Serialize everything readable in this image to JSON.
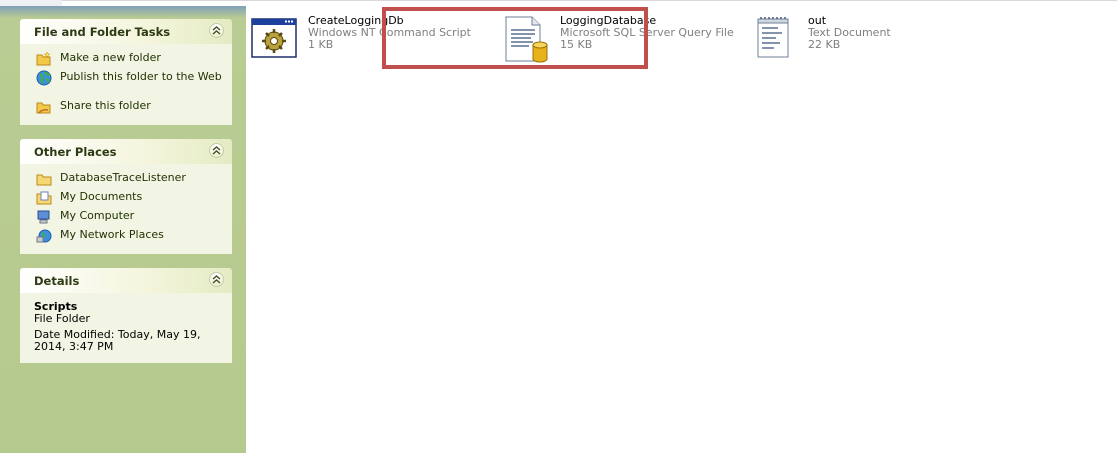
{
  "task_pane": {
    "file_folder_tasks": {
      "title": "File and Folder Tasks",
      "items": [
        {
          "label": "Make a new folder",
          "icon": "new-folder-icon"
        },
        {
          "label": "Publish this folder to the Web",
          "icon": "publish-web-icon"
        },
        {
          "label": "Share this folder",
          "icon": "share-folder-icon"
        }
      ]
    },
    "other_places": {
      "title": "Other Places",
      "items": [
        {
          "label": "DatabaseTraceListener",
          "icon": "folder-icon"
        },
        {
          "label": "My Documents",
          "icon": "my-documents-icon"
        },
        {
          "label": "My Computer",
          "icon": "my-computer-icon"
        },
        {
          "label": "My Network Places",
          "icon": "network-places-icon"
        }
      ]
    },
    "details": {
      "title": "Details",
      "name": "Scripts",
      "type": "File Folder",
      "modified": "Date Modified: Today, May 19, 2014, 3:47 PM"
    }
  },
  "files": [
    {
      "name": "CreateLoggingDb",
      "type": "Windows NT Command Script",
      "size": "1 KB",
      "icon": "command-script-icon"
    },
    {
      "name": "LoggingDatabase",
      "type": "Microsoft SQL Server Query File",
      "size": "15 KB",
      "icon": "sql-query-file-icon"
    },
    {
      "name": "out",
      "type": "Text Document",
      "size": "22 KB",
      "icon": "text-document-icon"
    }
  ],
  "colors": {
    "highlight_border": "#c0504d",
    "task_pane_background": "#b6c98e",
    "panel_body": "#f3f5e4"
  }
}
